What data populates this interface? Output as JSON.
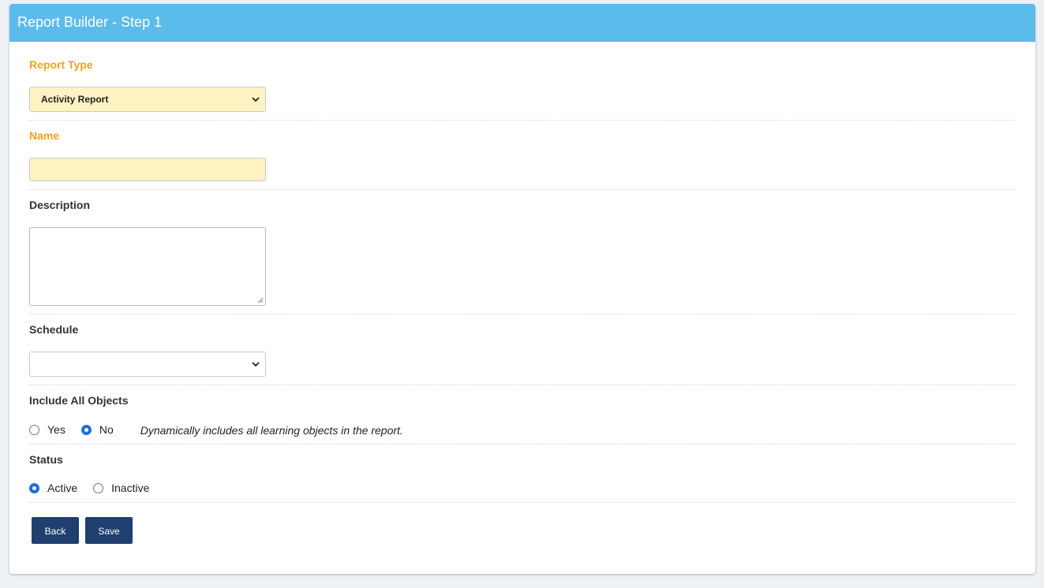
{
  "header": {
    "title": "Report Builder - Step 1"
  },
  "fields": {
    "report_type": {
      "label": "Report Type",
      "value": "Activity Report"
    },
    "name": {
      "label": "Name",
      "value": ""
    },
    "description": {
      "label": "Description",
      "value": ""
    },
    "schedule": {
      "label": "Schedule",
      "value": ""
    },
    "include_all_objects": {
      "label": "Include All Objects",
      "options": [
        "Yes",
        "No"
      ],
      "selected": "No",
      "hint": "Dynamically includes all learning objects in the report."
    },
    "status": {
      "label": "Status",
      "options": [
        "Active",
        "Inactive"
      ],
      "selected": "Active"
    }
  },
  "actions": {
    "back_label": "Back",
    "save_label": "Save"
  },
  "colors": {
    "header_bg": "#5bbbeb",
    "required_label": "#f2a31b",
    "highlight_field": "#fff3c4",
    "button_bg": "#1f3f6e",
    "radio_checked": "#1f6fd8"
  }
}
